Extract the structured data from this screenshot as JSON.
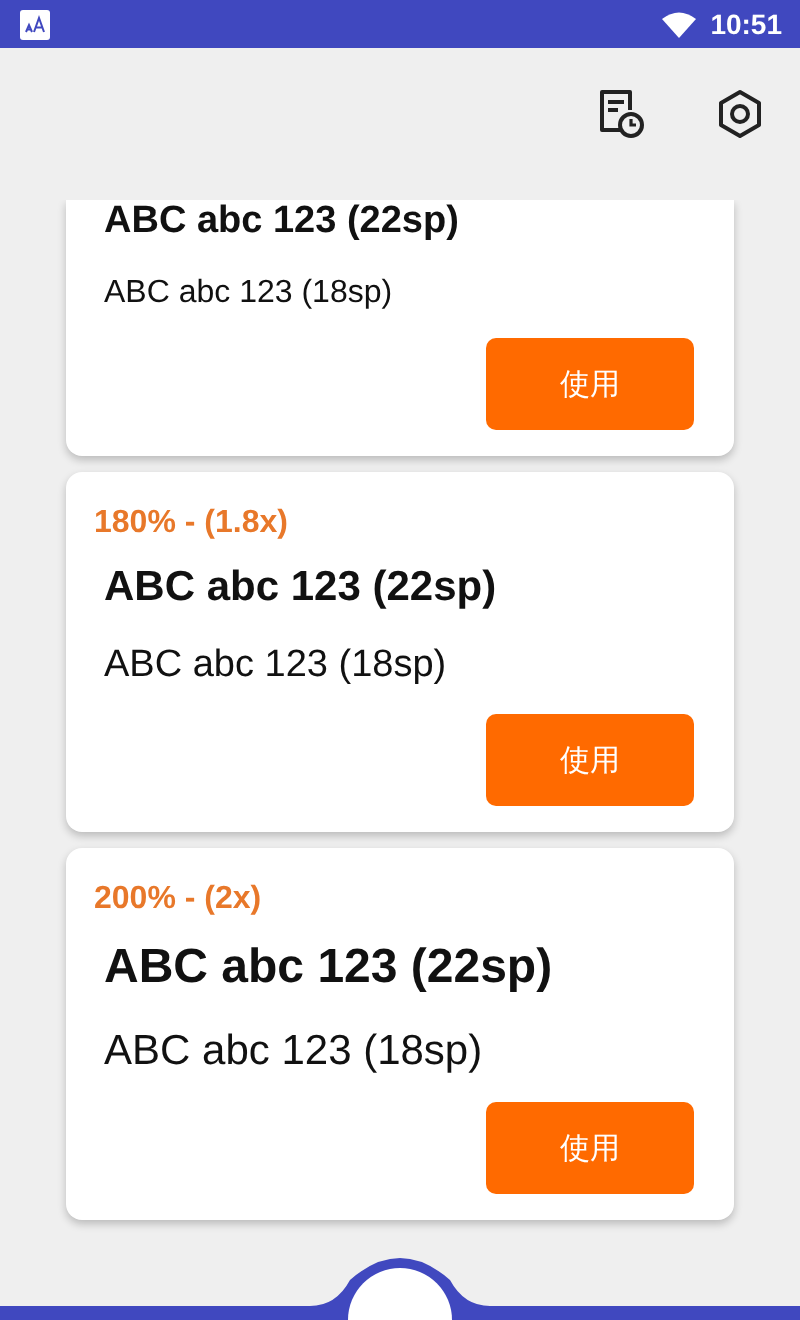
{
  "status_bar": {
    "time": "10:51"
  },
  "cards": [
    {
      "heading": "ABC abc 123 (22sp)",
      "body": "ABC abc 123 (18sp)",
      "button": "使用"
    },
    {
      "label": "180% - (1.8x)",
      "heading": "ABC abc 123 (22sp)",
      "body": "ABC abc 123 (18sp)",
      "button": "使用"
    },
    {
      "label": "200% - (2x)",
      "heading": "ABC abc 123 (22sp)",
      "body": "ABC abc 123 (18sp)",
      "button": "使用"
    }
  ]
}
